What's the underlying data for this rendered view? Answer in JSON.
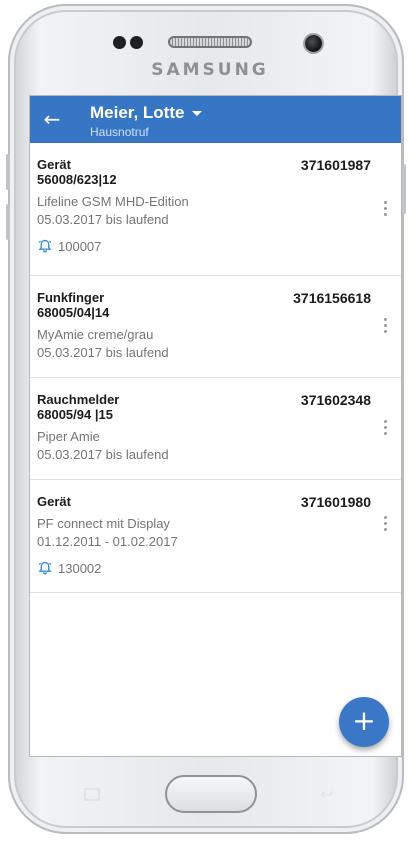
{
  "device": {
    "brand": "SAMSUNG"
  },
  "appbar": {
    "title": "Meier, Lotte",
    "subtitle": "Hausnotruf"
  },
  "devices": [
    {
      "type": "Gerät",
      "code": "56008/623|12",
      "number": "371601987",
      "description": "Lifeline GSM MHD-Edition",
      "period": "05.03.2017 bis laufend",
      "alarm_id": "100007"
    },
    {
      "type": "Funkfinger",
      "code": "68005/04|14",
      "number": "3716156618",
      "description": "MyAmie creme/grau",
      "period": "05.03.2017 bis laufend",
      "alarm_id": null
    },
    {
      "type": "Rauchmelder",
      "code": "68005/94 |15",
      "number": "371602348",
      "description": "Piper Amie",
      "period": "05.03.2017 bis laufend",
      "alarm_id": null
    },
    {
      "type": "Gerät",
      "code": null,
      "number": "371601980",
      "description": "PF connect mit Display",
      "period": "01.12.2011 - 01.02.2017",
      "alarm_id": "130002"
    }
  ],
  "fab": {
    "label": "+"
  },
  "icons": {
    "back": "arrow-left-icon",
    "dropdown": "caret-down-icon",
    "alarm": "alarm-bell-icon",
    "more": "more-vertical-icon"
  },
  "colors": {
    "appbar": "#3776c4",
    "fab": "#3a78c7",
    "alarm_icon": "#3b8fd6",
    "text_primary": "#1c1c1c",
    "text_secondary": "#757575"
  }
}
